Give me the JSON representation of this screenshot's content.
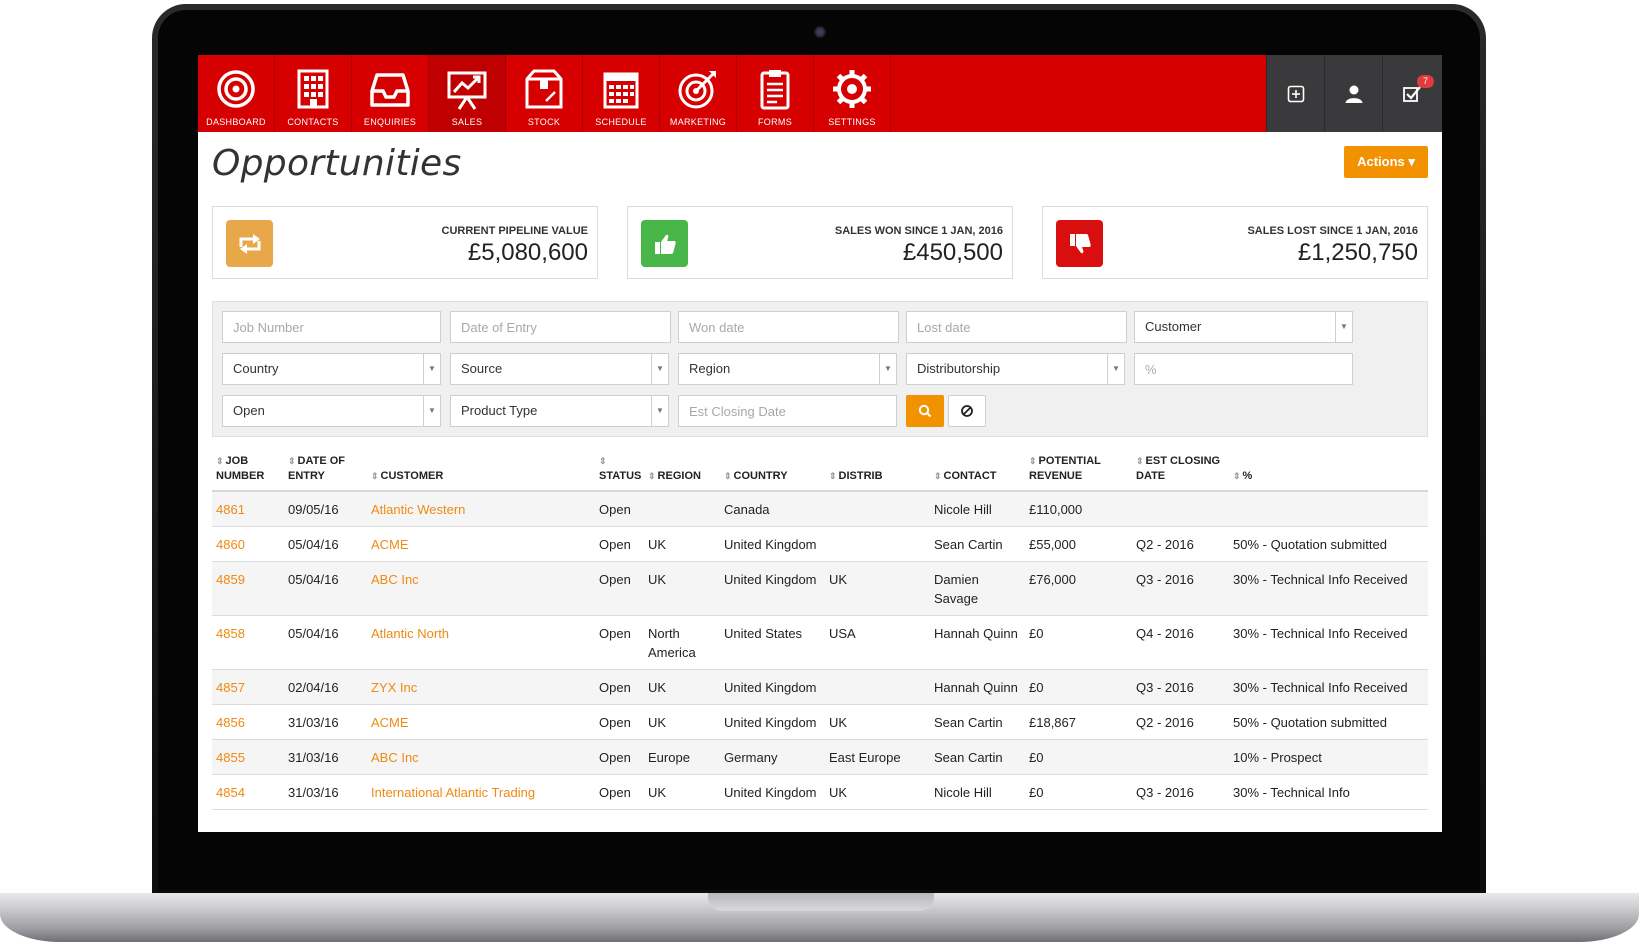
{
  "nav": [
    {
      "label": "DASHBOARD",
      "icon": "dashboard-icon"
    },
    {
      "label": "CONTACTS",
      "icon": "contacts-icon"
    },
    {
      "label": "ENQUIRIES",
      "icon": "inbox-icon"
    },
    {
      "label": "SALES",
      "icon": "presentation-chart-icon",
      "active": true
    },
    {
      "label": "STOCK",
      "icon": "box-icon"
    },
    {
      "label": "SCHEDULE",
      "icon": "calendar-icon"
    },
    {
      "label": "MARKETING",
      "icon": "target-icon"
    },
    {
      "label": "FORMS",
      "icon": "clipboard-icon"
    },
    {
      "label": "SETTINGS",
      "icon": "gear-icon"
    }
  ],
  "tools": {
    "notification_count": "7"
  },
  "page": {
    "title": "Opportunities",
    "actions_label": "Actions ▾"
  },
  "stats": [
    {
      "label": "CURRENT PIPELINE VALUE",
      "value": "£5,080,600",
      "color": "#e8a84a"
    },
    {
      "label": "SALES WON SINCE 1 JAN, 2016",
      "value": "£450,500",
      "color": "#49b64a"
    },
    {
      "label": "SALES LOST SINCE 1 JAN, 2016",
      "value": "£1,250,750",
      "color": "#d90f0f"
    }
  ],
  "filters": {
    "job_number": "Job Number",
    "date_of_entry": "Date of Entry",
    "won_date": "Won date",
    "lost_date": "Lost date",
    "customer": "Customer",
    "country": "Country",
    "source": "Source",
    "region": "Region",
    "distributorship": "Distributorship",
    "percent": "%",
    "status": "Open",
    "product_type": "Product Type",
    "est_closing_date": "Est Closing Date"
  },
  "table": {
    "headers": {
      "job_number": "JOB NUMBER",
      "date_of_entry": "DATE OF ENTRY",
      "customer": "CUSTOMER",
      "status": "STATUS",
      "region": "REGION",
      "country": "COUNTRY",
      "distrib": "DISTRIB",
      "contact": "CONTACT",
      "potential_revenue": "POTENTIAL REVENUE",
      "est_closing_date": "EST CLOSING DATE",
      "percent": "%"
    },
    "rows": [
      {
        "job": "4861",
        "date": "09/05/16",
        "customer": "Atlantic Western",
        "status": "Open",
        "region": "",
        "country": "Canada",
        "distrib": "",
        "contact": "Nicole Hill",
        "revenue": "£110,000",
        "closing": "",
        "percent": ""
      },
      {
        "job": "4860",
        "date": "05/04/16",
        "customer": "ACME",
        "status": "Open",
        "region": "UK",
        "country": "United Kingdom",
        "distrib": "",
        "contact": "Sean Cartin",
        "revenue": "£55,000",
        "closing": "Q2 - 2016",
        "percent": "50% - Quotation submitted"
      },
      {
        "job": "4859",
        "date": "05/04/16",
        "customer": "ABC Inc",
        "status": "Open",
        "region": "UK",
        "country": "United Kingdom",
        "distrib": "UK",
        "contact": "Damien Savage",
        "revenue": "£76,000",
        "closing": "Q3 - 2016",
        "percent": "30% - Technical Info Received"
      },
      {
        "job": "4858",
        "date": "05/04/16",
        "customer": "Atlantic North",
        "status": "Open",
        "region": "North America",
        "country": "United States",
        "distrib": "USA",
        "contact": "Hannah Quinn",
        "revenue": "£0",
        "closing": "Q4 - 2016",
        "percent": "30% - Technical Info Received"
      },
      {
        "job": "4857",
        "date": "02/04/16",
        "customer": "ZYX Inc",
        "status": "Open",
        "region": "UK",
        "country": "United Kingdom",
        "distrib": "",
        "contact": "Hannah Quinn",
        "revenue": "£0",
        "closing": "Q3 - 2016",
        "percent": "30% - Technical Info Received"
      },
      {
        "job": "4856",
        "date": "31/03/16",
        "customer": "ACME",
        "status": "Open",
        "region": "UK",
        "country": "United Kingdom",
        "distrib": "UK",
        "contact": "Sean Cartin",
        "revenue": "£18,867",
        "closing": "Q2 - 2016",
        "percent": "50% - Quotation submitted"
      },
      {
        "job": "4855",
        "date": "31/03/16",
        "customer": "ABC Inc",
        "status": "Open",
        "region": "Europe",
        "country": "Germany",
        "distrib": "East Europe",
        "contact": "Sean Cartin",
        "revenue": "£0",
        "closing": "",
        "percent": "10% - Prospect"
      },
      {
        "job": "4854",
        "date": "31/03/16",
        "customer": "International Atlantic Trading",
        "status": "Open",
        "region": "UK",
        "country": "United Kingdom",
        "distrib": "UK",
        "contact": "Nicole Hill",
        "revenue": "£0",
        "closing": "Q3 - 2016",
        "percent": "30% - Technical Info"
      }
    ]
  },
  "colors": {
    "brand_red": "#d60000",
    "accent_orange": "#f39200",
    "link_orange": "#ef8a12",
    "toolbar_dark": "#3a3a3c"
  }
}
